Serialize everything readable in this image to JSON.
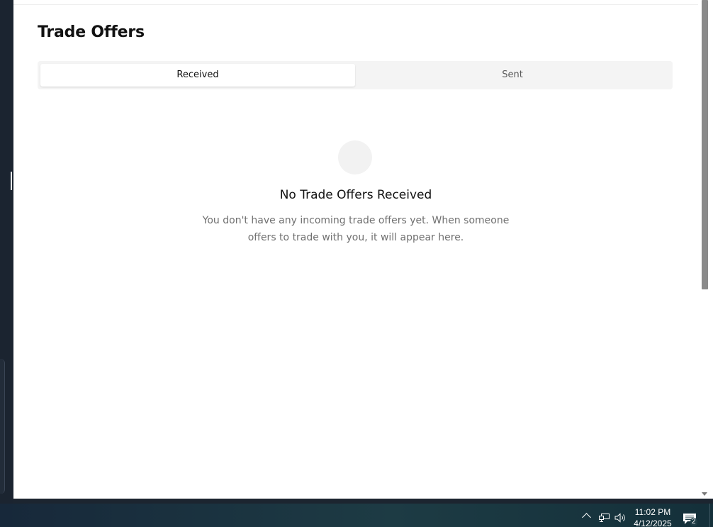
{
  "page": {
    "title": "Trade Offers"
  },
  "tabs": [
    {
      "label": "Received",
      "active": true
    },
    {
      "label": "Sent",
      "active": false
    }
  ],
  "empty_state": {
    "icon": "empty-circle-icon",
    "title": "No Trade Offers Received",
    "description": "You don't have any incoming trade offers yet. When someone offers to trade with you, it will appear here."
  },
  "taskbar": {
    "time": "11:02 PM",
    "date": "4/12/2025",
    "notification_count": "2",
    "icons": [
      "chevron-up-icon",
      "network-icon",
      "volume-icon",
      "notification-icon"
    ]
  },
  "colors": {
    "window_bg": "#ffffff",
    "tab_track": "#f4f4f4",
    "title_text": "#111111",
    "muted_text": "#707070",
    "desktop_bg": "#1b2430"
  }
}
